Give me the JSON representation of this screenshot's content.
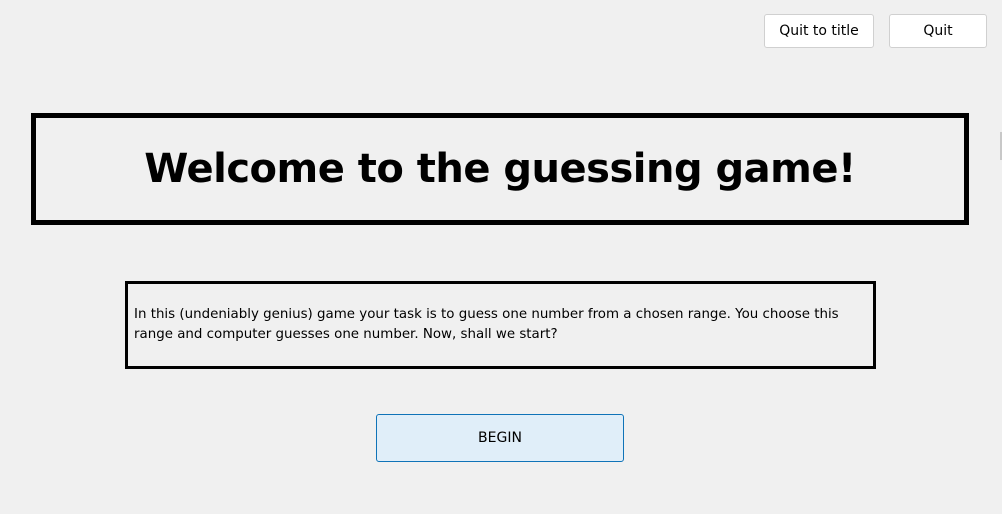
{
  "toolbar": {
    "quit_to_title_label": "Quit to title",
    "quit_label": "Quit"
  },
  "main": {
    "title": "Welcome to the guessing game!",
    "description": "In this (undeniably genius) game your task is to guess one number from a chosen range. You choose this range and computer guesses one number. Now, shall we start?",
    "begin_label": "BEGIN"
  },
  "colors": {
    "background": "#f0f0f0",
    "border": "#000000",
    "begin_fill": "#e0eef9",
    "begin_border": "#0f73b8"
  }
}
